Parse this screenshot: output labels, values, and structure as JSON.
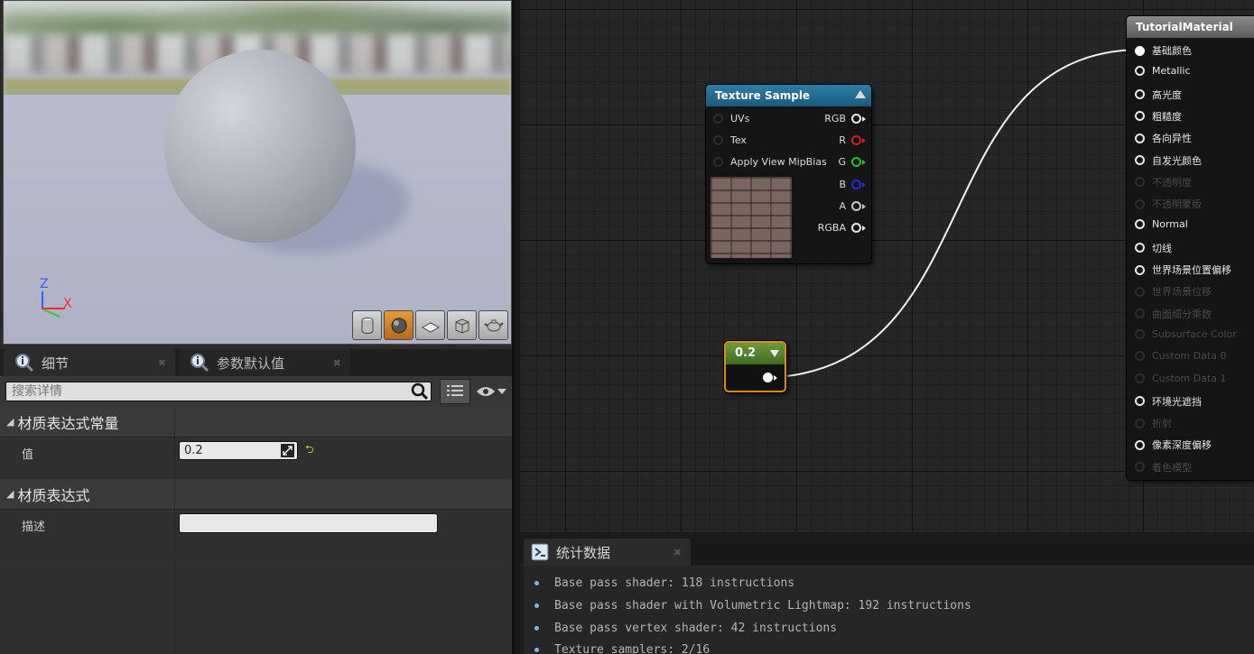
{
  "viewport": {
    "axis": {
      "z": "Z",
      "x": "X"
    },
    "tools": [
      "cylinder-preview",
      "sphere-preview",
      "plane-preview",
      "cube-preview",
      "custom-mesh-preview"
    ],
    "active_tool": "sphere-preview"
  },
  "details": {
    "tabs": [
      {
        "label": "细节",
        "icon": "info-search-icon"
      },
      {
        "label": "参数默认值",
        "icon": "info-search-icon"
      }
    ],
    "search_placeholder": "搜索详情",
    "categories": [
      {
        "title": "材质表达式常量",
        "prop_name": "值",
        "prop_value": "0.2"
      },
      {
        "title": "材质表达式",
        "prop_name": "描述",
        "prop_value": ""
      }
    ]
  },
  "graph": {
    "texture_node": {
      "title": "Texture Sample",
      "inputs": [
        "UVs",
        "Tex",
        "Apply View MipBias"
      ],
      "outputs": [
        {
          "label": "RGB",
          "color": "#e8e8e8"
        },
        {
          "label": "R",
          "color": "#d12020"
        },
        {
          "label": "G",
          "color": "#22c422"
        },
        {
          "label": "B",
          "color": "#2030d8"
        },
        {
          "label": "A",
          "color": "#c8c8c8"
        },
        {
          "label": "RGBA",
          "color": "#e8e8e8"
        }
      ]
    },
    "constant_node": {
      "value": "0.2"
    },
    "material_node": {
      "title": "TutorialMaterial",
      "inputs": [
        {
          "label": "基础颜色",
          "enabled": true,
          "connected": true
        },
        {
          "label": "Metallic",
          "enabled": true
        },
        {
          "label": "高光度",
          "enabled": true
        },
        {
          "label": "粗糙度",
          "enabled": true
        },
        {
          "label": "各向异性",
          "enabled": true
        },
        {
          "label": "自发光颜色",
          "enabled": true
        },
        {
          "label": "不透明度",
          "enabled": false
        },
        {
          "label": "不透明蒙版",
          "enabled": false
        },
        {
          "label": "Normal",
          "enabled": true
        },
        {
          "label": "切线",
          "enabled": true
        },
        {
          "label": "世界场景位置偏移",
          "enabled": true
        },
        {
          "label": "世界场景位移",
          "enabled": false
        },
        {
          "label": "曲面细分乘数",
          "enabled": false
        },
        {
          "label": "Subsurface Color",
          "enabled": false
        },
        {
          "label": "Custom Data 0",
          "enabled": false
        },
        {
          "label": "Custom Data 1",
          "enabled": false
        },
        {
          "label": "环境光遮挡",
          "enabled": true
        },
        {
          "label": "折射",
          "enabled": false
        },
        {
          "label": "像素深度偏移",
          "enabled": true
        },
        {
          "label": "着色模型",
          "enabled": false
        }
      ]
    }
  },
  "stats": {
    "tab_label": "统计数据",
    "lines": [
      "Base pass shader: 118 instructions",
      "Base pass shader with Volumetric Lightmap: 192 instructions",
      "Base pass vertex shader: 42 instructions",
      "Texture samplers: 2/16"
    ]
  }
}
